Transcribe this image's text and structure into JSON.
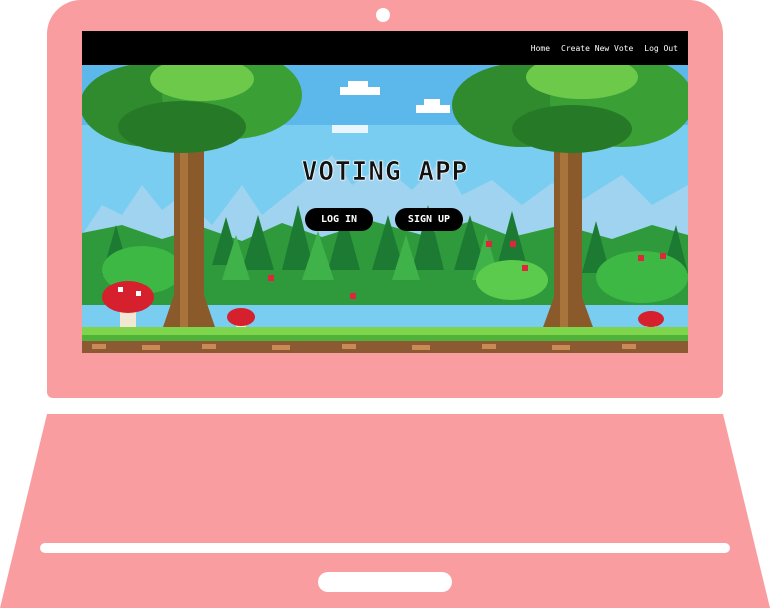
{
  "navbar": {
    "links": [
      "Home",
      "Create New Vote",
      "Log Out"
    ]
  },
  "hero": {
    "title": "VOTING APP",
    "login_label": "LOG IN",
    "signup_label": "SIGN UP"
  },
  "colors": {
    "laptop": "#f99da0",
    "navbar": "#000000",
    "sky": "#6cc6ea",
    "button": "#000000"
  }
}
